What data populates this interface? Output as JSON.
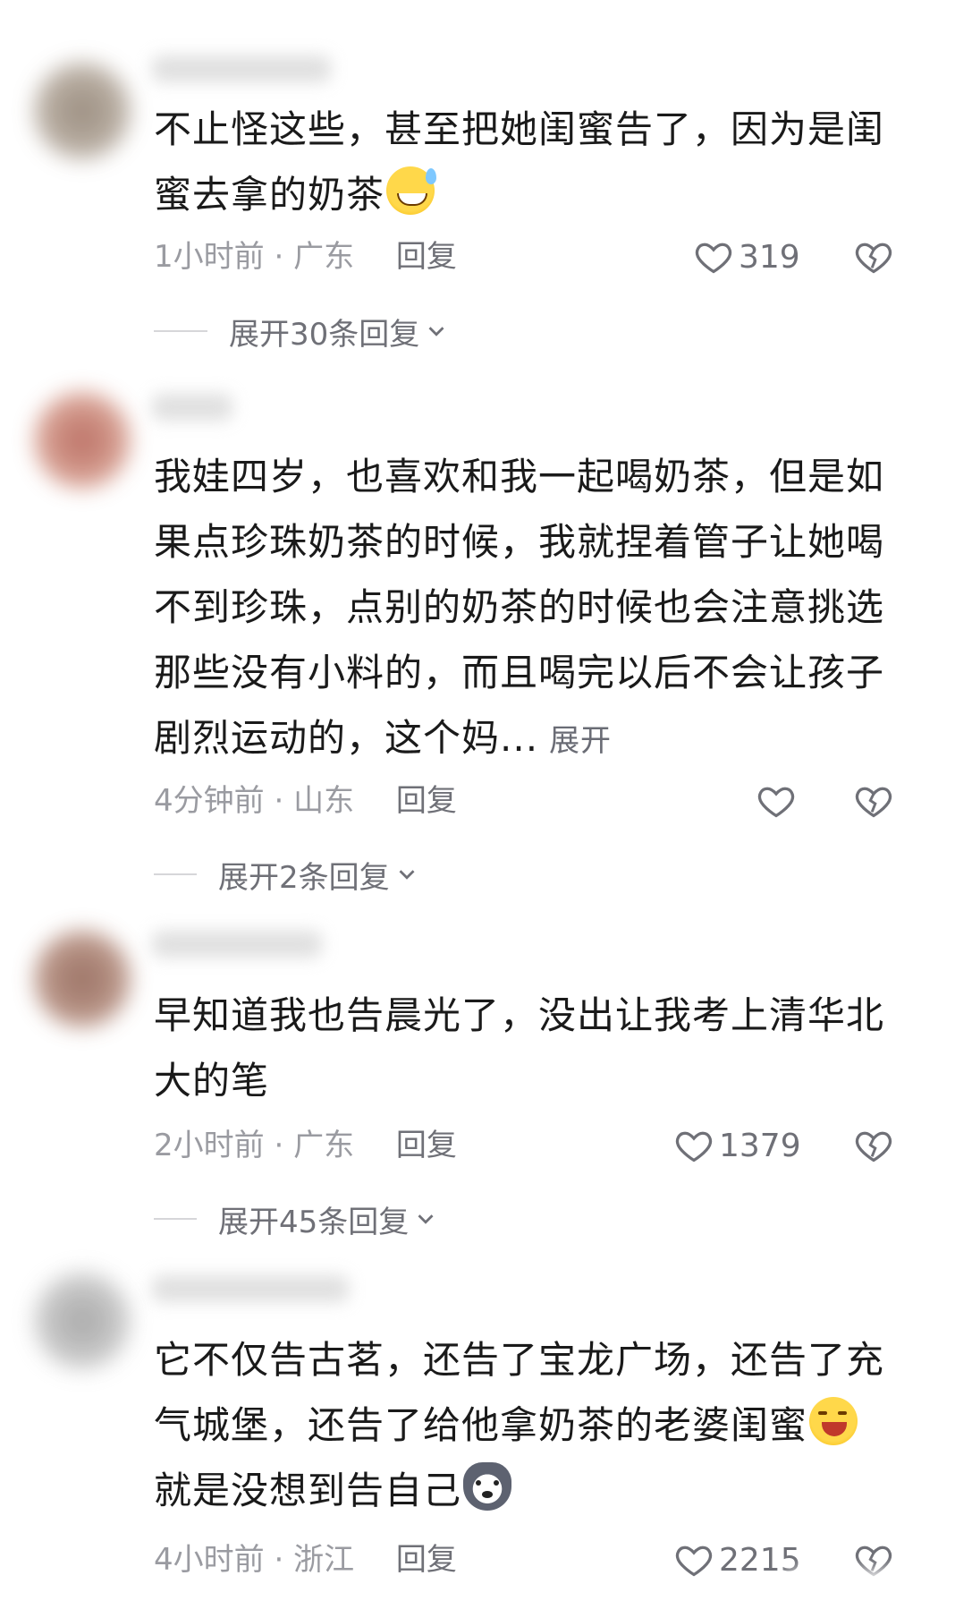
{
  "comments": [
    {
      "body": "不止怪这些，甚至把她闺蜜告了，因为是闺蜜去拿的奶茶",
      "emoji": "sweat-grin-emoji",
      "time": "1小时前",
      "location": "广东",
      "reply_label": "回复",
      "likes": "319",
      "expand_replies": "展开30条回复"
    },
    {
      "body": "我娃四岁，也喜欢和我一起喝奶茶，但是如果点珍珠奶茶的时候，我就捏着管子让她喝不到珍珠，点别的奶茶的时候也会注意挑选那些没有小料的，而且喝完以后不会让孩子剧烈运动的，这个妈...",
      "expand_text": "展开",
      "time": "4分钟前",
      "location": "山东",
      "reply_label": "回复",
      "likes": "",
      "expand_replies": "展开2条回复"
    },
    {
      "body": "早知道我也告晨光了，没出让我考上清华北大的笔",
      "time": "2小时前",
      "location": "广东",
      "reply_label": "回复",
      "likes": "1379",
      "expand_replies": "展开45条回复"
    },
    {
      "body_line1": "它不仅告古茗，还告了宝龙广场，还告了充",
      "body_line2": "气城堡，还告了给他拿奶茶的老婆闺蜜",
      "body_line3": "就是没想到告自己",
      "emoji_a": "wink-tongue-emoji",
      "emoji_b": "husky-dog-emoji",
      "time": "4小时前",
      "location": "浙江",
      "reply_label": "回复",
      "likes": "2215"
    }
  ],
  "colors": {
    "text": "#1a1a1a",
    "meta": "#9a9ba1",
    "secondary": "#6f7077"
  }
}
